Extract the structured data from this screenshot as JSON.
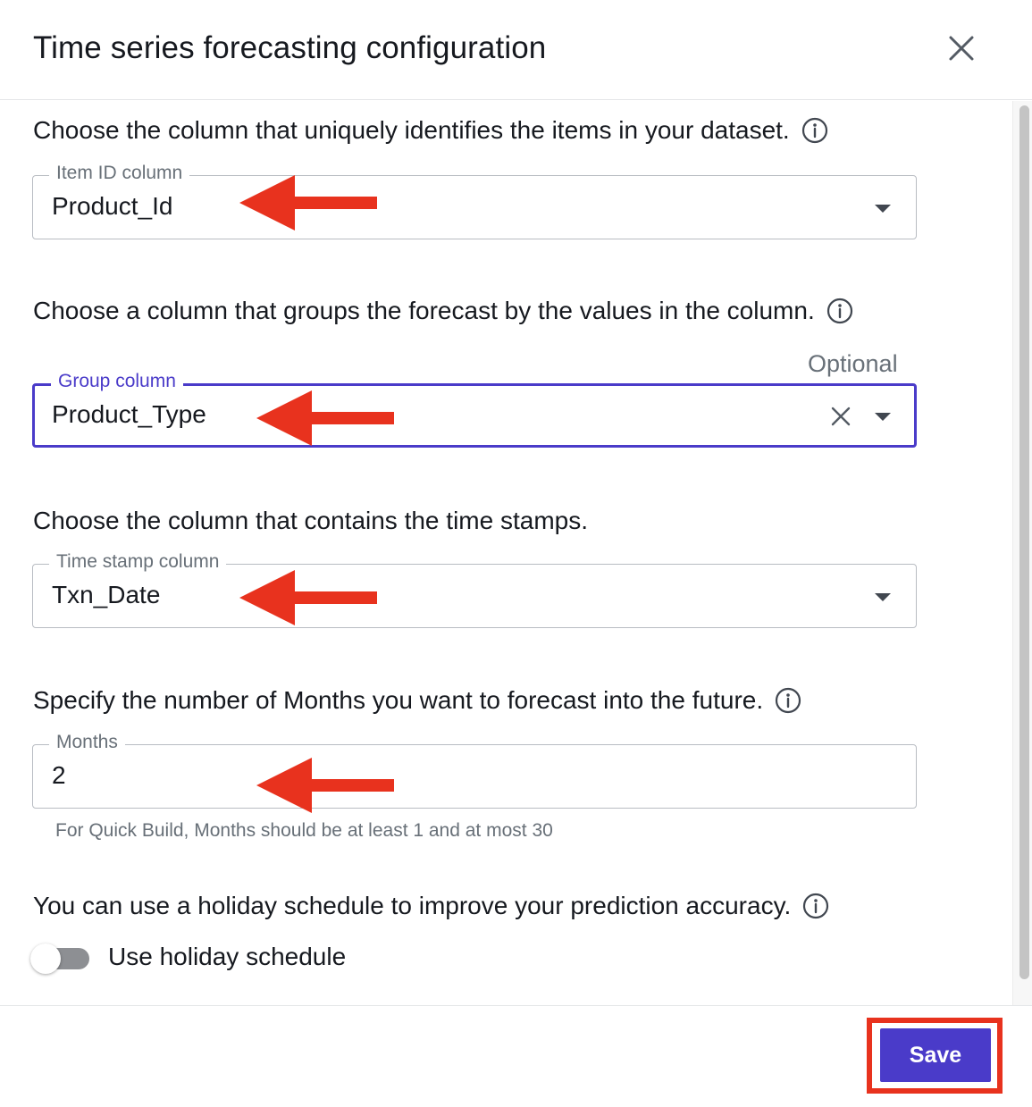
{
  "dialog": {
    "title": "Time series forecasting configuration"
  },
  "item_id": {
    "prompt": "Choose the column that uniquely identifies the items in your dataset.",
    "label": "Item ID column",
    "value": "Product_Id"
  },
  "group": {
    "prompt": "Choose a column that groups the forecast by the values in the column.",
    "optional_label": "Optional",
    "label": "Group column",
    "value": "Product_Type"
  },
  "timestamp": {
    "prompt": "Choose the column that contains the time stamps.",
    "label": "Time stamp column",
    "value": "Txn_Date"
  },
  "horizon": {
    "prompt": "Specify the number of Months you want to forecast into the future.",
    "label": "Months",
    "value": "2",
    "hint": "For Quick Build, Months should be at least 1 and at most 30"
  },
  "holiday": {
    "prompt": "You can use a holiday schedule to improve your prediction accuracy.",
    "toggle_label": "Use holiday schedule",
    "enabled": false
  },
  "footer": {
    "save_label": "Save"
  },
  "colors": {
    "accent": "#4a3bc9",
    "annotation_red": "#e8321e",
    "text": "#16191f",
    "muted": "#687078"
  }
}
